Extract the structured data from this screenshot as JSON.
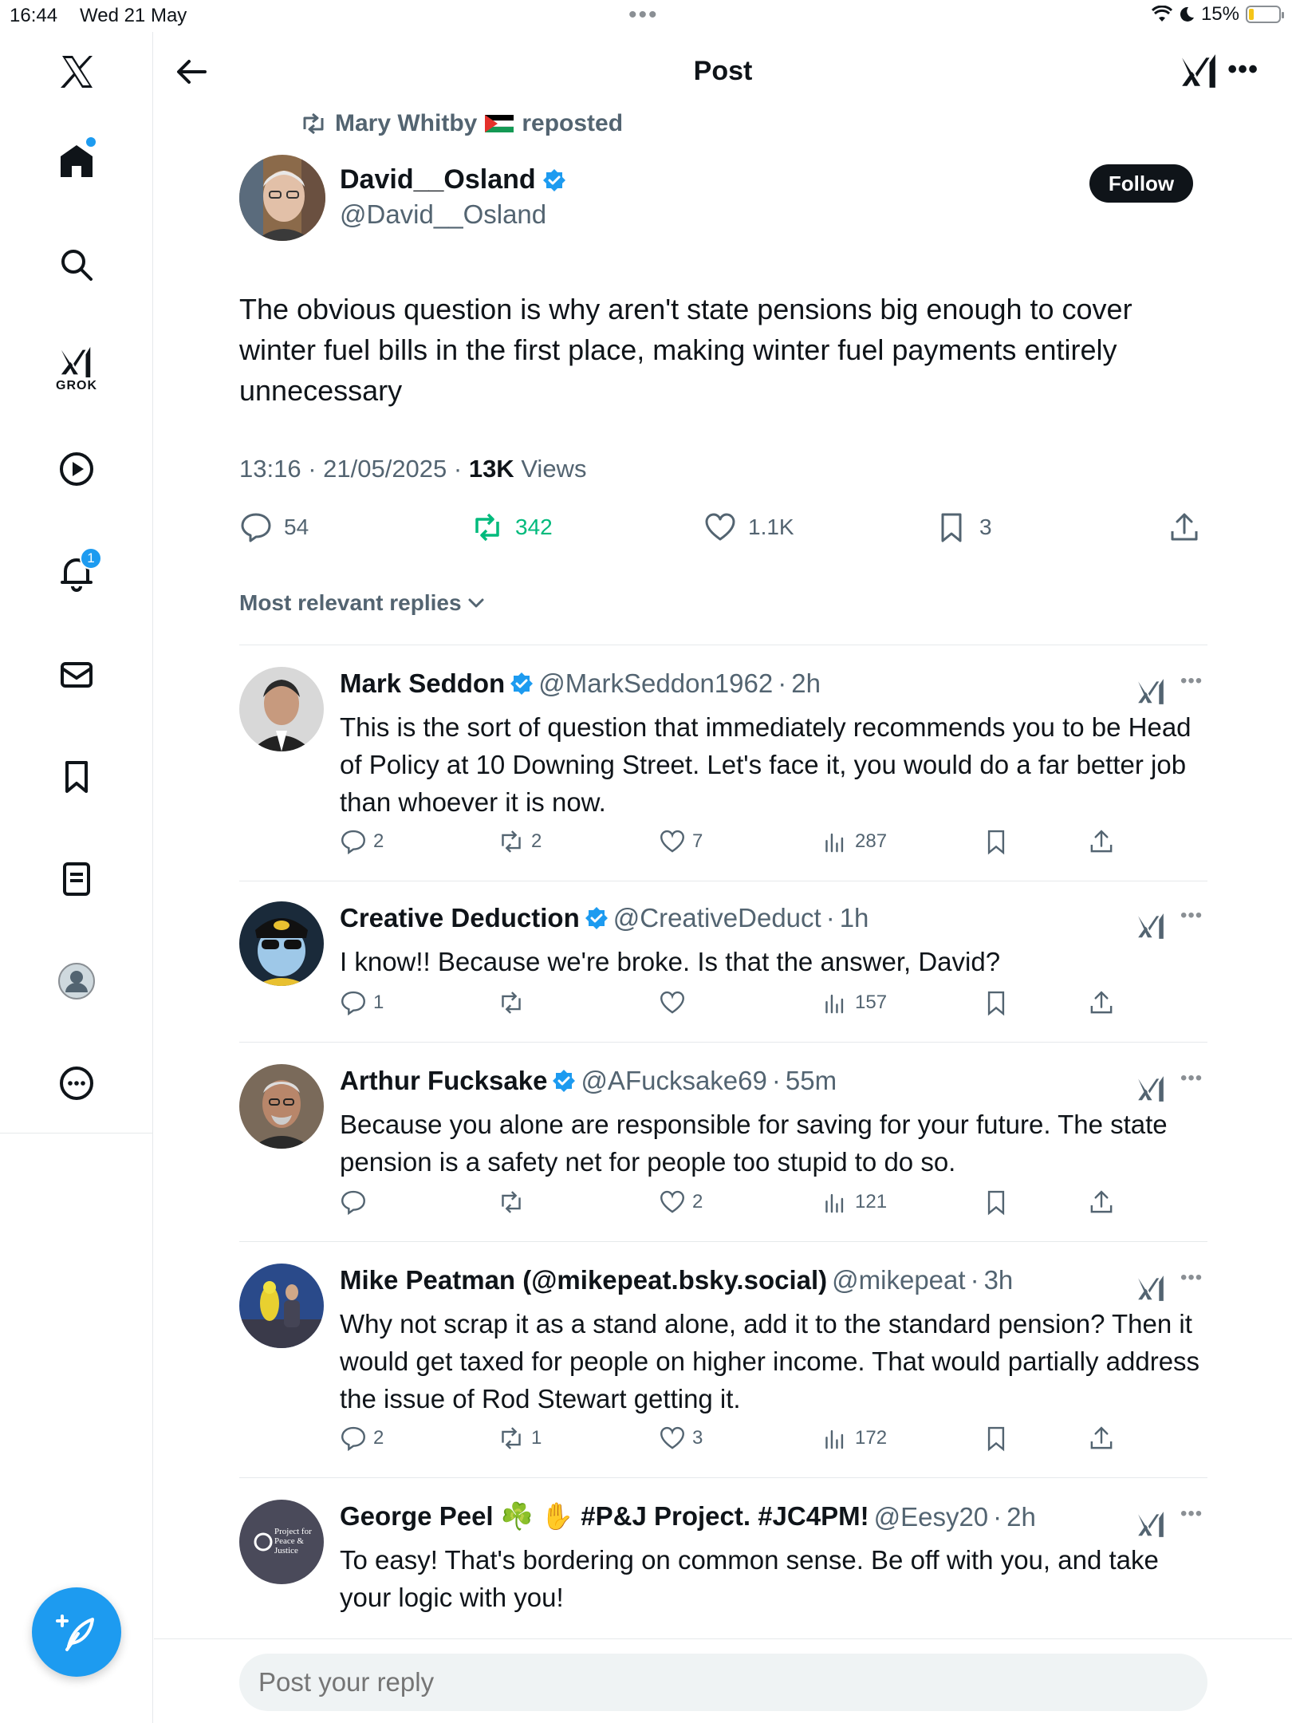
{
  "status_bar": {
    "time": "16:44",
    "date": "Wed 21 May",
    "battery": "15%"
  },
  "header": {
    "title": "Post"
  },
  "sidebar": {
    "grok_label": "GROK",
    "notification_count": "1"
  },
  "post": {
    "repost_by": "Mary Whitby",
    "repost_suffix": "reposted",
    "author_name": "David__Osland",
    "author_handle": "@David__Osland",
    "follow_label": "Follow",
    "text": "The obvious question is why aren't state pensions big enough to cover winter fuel bills in the first place, making winter fuel payments entirely unnecessary",
    "timestamp": "13:16 · 21/05/2025 · ",
    "views_count": "13K",
    "views_label": " Views",
    "replies": "54",
    "reposts": "342",
    "likes": "1.1K",
    "bookmarks": "3"
  },
  "replies_sort": "Most relevant replies",
  "replies": [
    {
      "name": "Mark Seddon",
      "handle": "@MarkSeddon1962",
      "time": "2h",
      "text": "This is the sort of question that immediately recommends you to be Head of Policy at 10 Downing Street. Let's face it, you would do a far better job than whoever it is now.",
      "replies": "2",
      "reposts": "2",
      "likes": "7",
      "views": "287"
    },
    {
      "name": "Creative Deduction",
      "handle": "@CreativeDeduct",
      "time": "1h",
      "text": "I know!! Because we're broke. Is that the answer, David?",
      "replies": "1",
      "reposts": "",
      "likes": "",
      "views": "157"
    },
    {
      "name": "Arthur Fucksake",
      "handle": "@AFucksake69",
      "time": "55m",
      "text": "Because you alone are responsible for saving for your future. The state pension is a safety net for people too stupid to do so.",
      "replies": "",
      "reposts": "",
      "likes": "2",
      "views": "121"
    },
    {
      "name": "Mike Peatman (@mikepeat.bsky.social)",
      "handle": "@mikepeat",
      "time": "3h",
      "text": "Why not scrap it as a stand alone, add it to the standard pension? Then it would get taxed for people on higher income. That would partially address the issue of Rod Stewart getting it.",
      "replies": "2",
      "reposts": "1",
      "likes": "3",
      "views": "172"
    },
    {
      "name": "George Peel ☘️ ✋ #P&J Project. #JC4PM!",
      "handle": "@Eesy20",
      "time": "2h",
      "text": "To easy!  That's bordering on common sense.  Be off with you, and take your logic with you!",
      "avatar_text": "Project for Peace & Justice"
    }
  ],
  "reply_box": {
    "placeholder": "Post your reply"
  },
  "colors": {
    "accent": "#1d9bf0",
    "repost_green": "#00ba7c",
    "muted": "#536471"
  }
}
